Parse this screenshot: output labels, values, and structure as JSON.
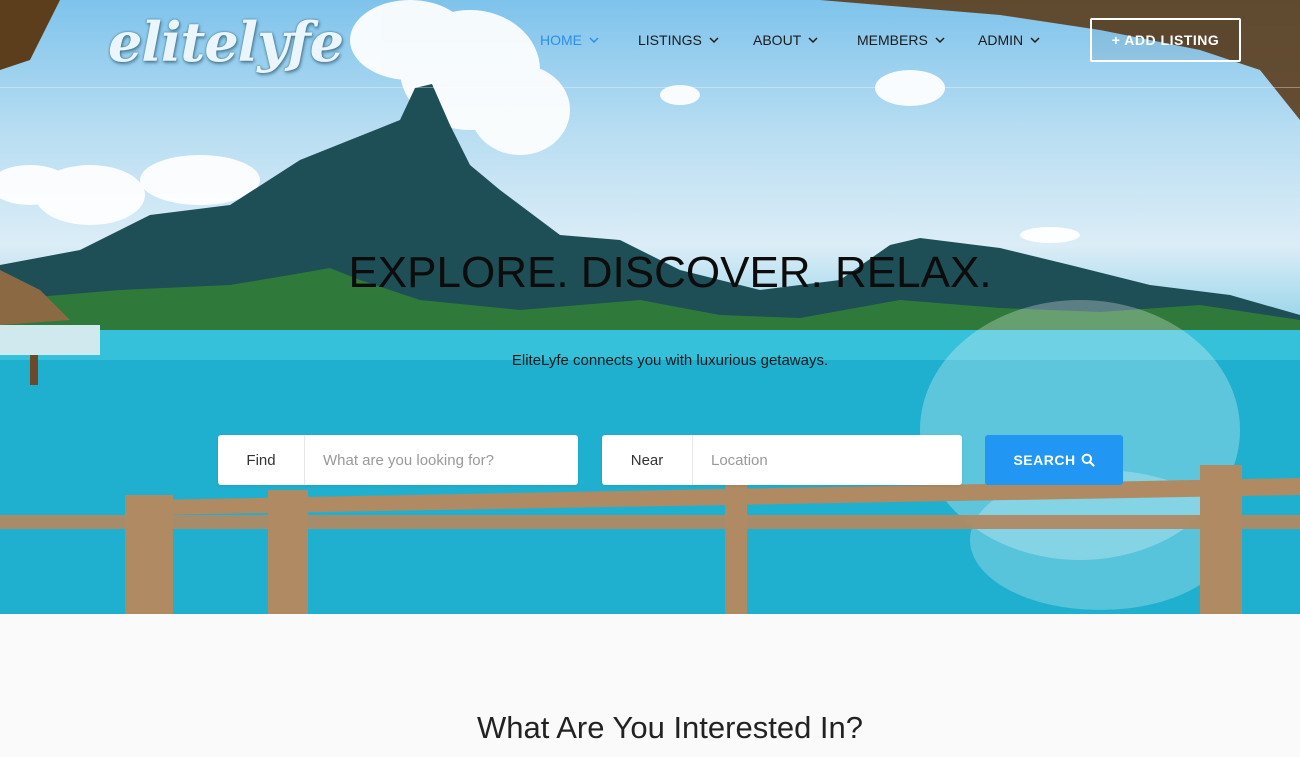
{
  "brand": {
    "logo_text": "elitelyfe"
  },
  "nav": {
    "items": [
      {
        "label": "HOME",
        "icon": "chevron-down-icon"
      },
      {
        "label": "LISTINGS",
        "icon": "chevron-down-icon"
      },
      {
        "label": "ABOUT",
        "icon": "chevron-down-icon"
      },
      {
        "label": "MEMBERS",
        "icon": "chevron-down-icon"
      },
      {
        "label": "ADMIN",
        "icon": "chevron-down-icon"
      }
    ],
    "active": "HOME",
    "add_listing_label": "+ ADD LISTING"
  },
  "hero": {
    "headline": "EXPLORE. DISCOVER. RELAX.",
    "tagline": "EliteLyfe connects you with luxurious getaways."
  },
  "search": {
    "find_label": "Find",
    "find_placeholder": "What are you looking for?",
    "near_label": "Near",
    "near_placeholder": "Location",
    "button_label": "SEARCH",
    "button_icon": "search-icon"
  },
  "section": {
    "title": "What Are You Interested In?"
  },
  "colors": {
    "accent": "#2196f3",
    "nav_active": "#2b8fe6",
    "page_bg": "#fafafa"
  }
}
